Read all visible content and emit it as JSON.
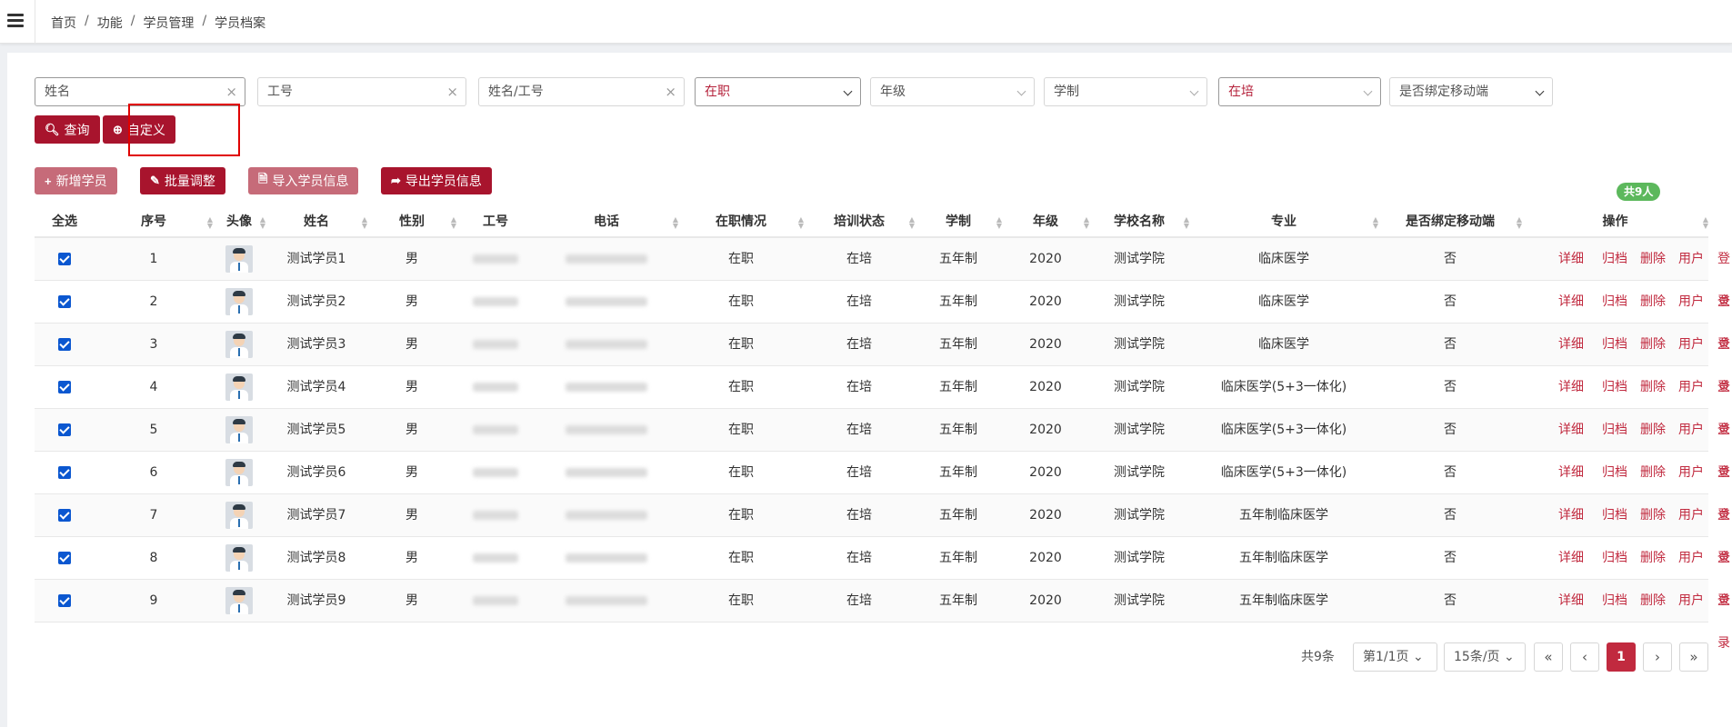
{
  "breadcrumb": [
    "首页",
    "功能",
    "学员管理",
    "学员档案"
  ],
  "filters": {
    "name": {
      "value": "姓名"
    },
    "job_no": {
      "placeholder": "工号"
    },
    "name_or_job": {
      "placeholder": "姓名/工号"
    },
    "employment": {
      "value": "在职"
    },
    "grade": {
      "value": "年级"
    },
    "system": {
      "value": "学制"
    },
    "training": {
      "value": "在培"
    },
    "mobile_bound": {
      "value": "是否绑定移动端"
    }
  },
  "search_buttons": {
    "query": "查询",
    "custom": "自定义"
  },
  "toolbar": {
    "add": "新增学员",
    "batch": "批量调整",
    "import": "导入学员信息",
    "export": "导出学员信息"
  },
  "count_badge": "共9人",
  "columns": [
    "全选",
    "序号",
    "头像",
    "姓名",
    "性别",
    "工号",
    "电话",
    "在职情况",
    "培训状态",
    "学制",
    "年级",
    "学校名称",
    "专业",
    "是否绑定移动端",
    "操作"
  ],
  "actions": [
    "详细",
    "归档",
    "删除",
    "用户",
    "登录"
  ],
  "rows": [
    {
      "seq": "1",
      "name": "测试学员1",
      "gender": "男",
      "emp": "在职",
      "train": "在培",
      "system": "五年制",
      "grade": "2020",
      "school": "测试学院",
      "major": "临床医学",
      "bound": "否"
    },
    {
      "seq": "2",
      "name": "测试学员2",
      "gender": "男",
      "emp": "在职",
      "train": "在培",
      "system": "五年制",
      "grade": "2020",
      "school": "测试学院",
      "major": "临床医学",
      "bound": "否"
    },
    {
      "seq": "3",
      "name": "测试学员3",
      "gender": "男",
      "emp": "在职",
      "train": "在培",
      "system": "五年制",
      "grade": "2020",
      "school": "测试学院",
      "major": "临床医学",
      "bound": "否"
    },
    {
      "seq": "4",
      "name": "测试学员4",
      "gender": "男",
      "emp": "在职",
      "train": "在培",
      "system": "五年制",
      "grade": "2020",
      "school": "测试学院",
      "major": "临床医学(5+3一体化)",
      "bound": "否"
    },
    {
      "seq": "5",
      "name": "测试学员5",
      "gender": "男",
      "emp": "在职",
      "train": "在培",
      "system": "五年制",
      "grade": "2020",
      "school": "测试学院",
      "major": "临床医学(5+3一体化)",
      "bound": "否"
    },
    {
      "seq": "6",
      "name": "测试学员6",
      "gender": "男",
      "emp": "在职",
      "train": "在培",
      "system": "五年制",
      "grade": "2020",
      "school": "测试学院",
      "major": "临床医学(5+3一体化)",
      "bound": "否"
    },
    {
      "seq": "7",
      "name": "测试学员7",
      "gender": "男",
      "emp": "在职",
      "train": "在培",
      "system": "五年制",
      "grade": "2020",
      "school": "测试学院",
      "major": "五年制临床医学",
      "bound": "否"
    },
    {
      "seq": "8",
      "name": "测试学员8",
      "gender": "男",
      "emp": "在职",
      "train": "在培",
      "system": "五年制",
      "grade": "2020",
      "school": "测试学院",
      "major": "五年制临床医学",
      "bound": "否"
    },
    {
      "seq": "9",
      "name": "测试学员9",
      "gender": "男",
      "emp": "在职",
      "train": "在培",
      "system": "五年制",
      "grade": "2020",
      "school": "测试学院",
      "major": "五年制临床医学",
      "bound": "否"
    }
  ],
  "pagination": {
    "total": "共9条",
    "page_select": "第1/1页",
    "size_select": "15条/页",
    "current": "1"
  }
}
